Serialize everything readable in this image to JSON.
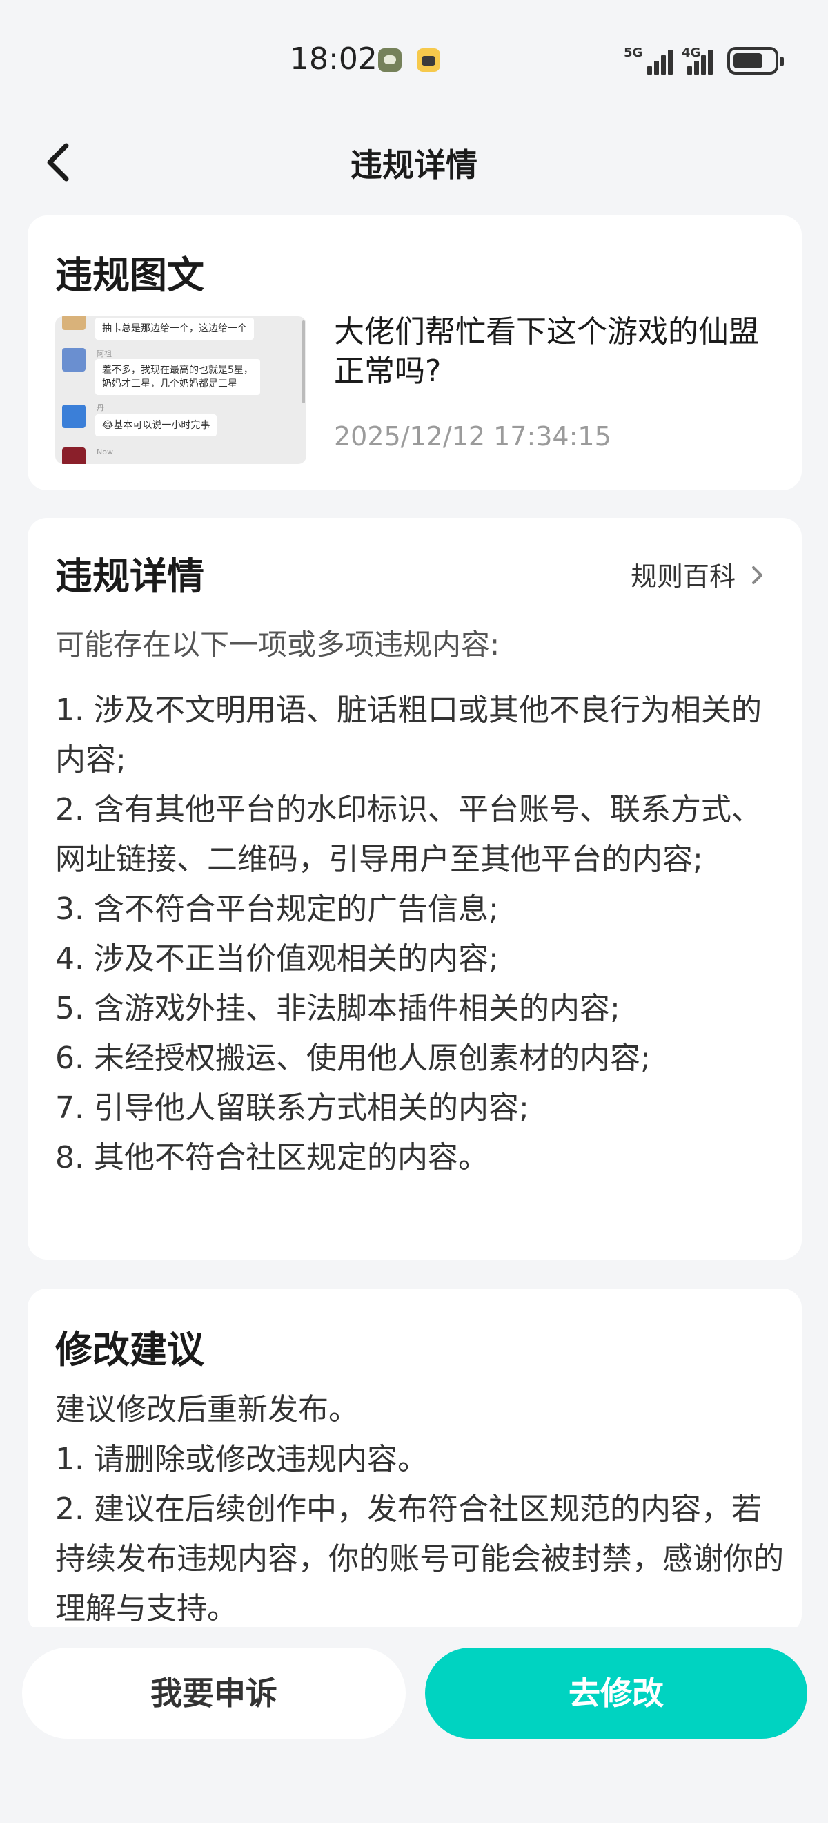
{
  "status_bar": {
    "time": "18:02",
    "signal_1": "5G",
    "signal_2": "4G"
  },
  "nav": {
    "title": "违规详情"
  },
  "post_card": {
    "section_title": "违规图文",
    "thumbnail_chat": {
      "line_1": "抽卡总是那边给一个，这边给一个",
      "name_1": "阿祖",
      "line_2a": "差不多，我现在最高的也就是5星，",
      "line_2b": "奶妈才三星，几个奶妈都是三星",
      "name_2": "丹",
      "line_3": "😂基本可以说一小时完事",
      "label_now": "Now"
    },
    "post_title": "大佬们帮忙看下这个游戏的仙盟正常吗?",
    "post_time": "2025/12/12 17:34:15"
  },
  "details_card": {
    "section_title": "违规详情",
    "rules_link": "规则百科",
    "intro": "可能存在以下一项或多项违规内容:",
    "items": [
      "1. 涉及不文明用语、脏话粗口或其他不良行为相关的内容;",
      "2. 含有其他平台的水印标识、平台账号、联系方式、网址链接、二维码，引导用户至其他平台的内容;",
      "3. 含不符合平台规定的广告信息;",
      "4. 涉及不正当价值观相关的内容;",
      "5. 含游戏外挂、非法脚本插件相关的内容;",
      "6. 未经授权搬运、使用他人原创素材的内容;",
      "7. 引导他人留联系方式相关的内容;",
      "8. 其他不符合社区规定的内容。"
    ]
  },
  "suggestion_card": {
    "section_title": "修改建议",
    "lines": [
      "建议修改后重新发布。",
      "1. 请删除或修改违规内容。",
      "2. 建议在后续创作中，发布符合社区规范的内容，若持续发布违规内容，你的账号可能会被封禁，感谢你的理解与支持。"
    ]
  },
  "actions": {
    "appeal": "我要申诉",
    "edit": "去修改"
  },
  "colors": {
    "accent": "#00d3c1",
    "background": "#f4f5f7",
    "card": "#ffffff"
  }
}
